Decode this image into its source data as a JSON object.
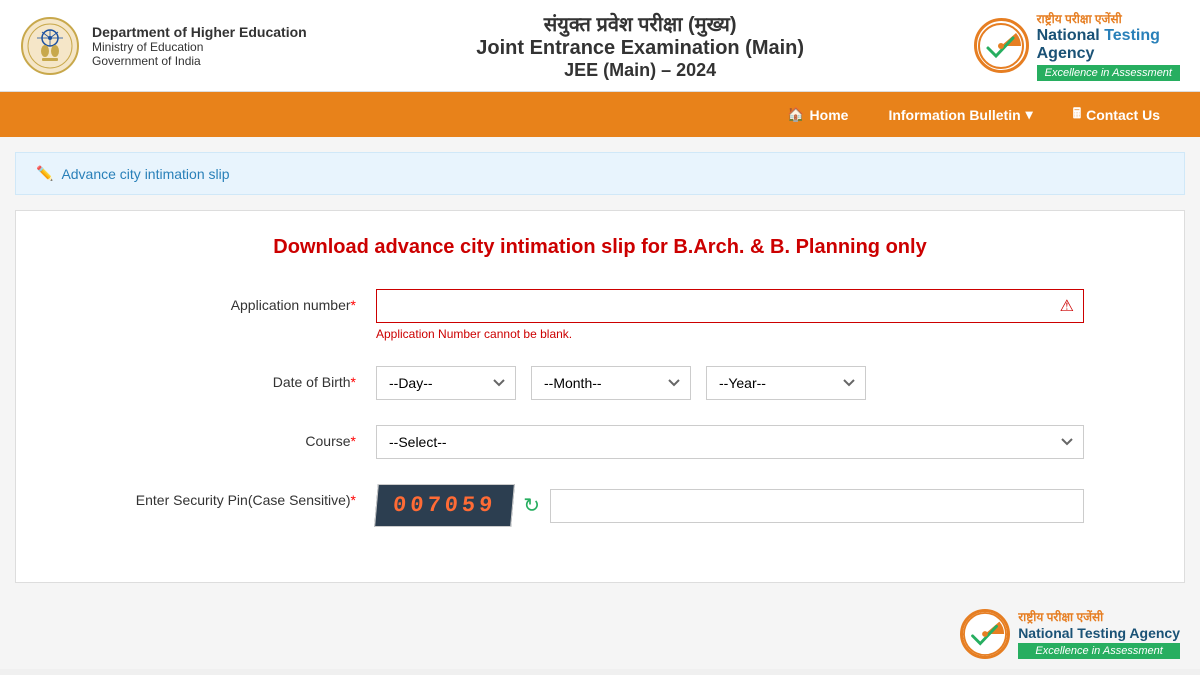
{
  "header": {
    "dept_name": "Department of Higher Education",
    "ministry": "Ministry of Education",
    "govt": "Government of India",
    "hindi_title": "संयुक्त प्रवेश परीक्षा (मुख्य)",
    "eng_title": "Joint Entrance Examination (Main)",
    "year_title": "JEE (Main) – 2024",
    "nta_hindi": "राष्ट्रीय परीक्षा एजेंसी",
    "nta_eng_national": "National",
    "nta_eng_testing": "Testing",
    "nta_eng_agency": "Agency",
    "nta_tagline": "Excellence in Assessment"
  },
  "navbar": {
    "home_label": "Home",
    "info_bulletin_label": "Information Bulletin",
    "contact_us_label": "Contact Us"
  },
  "breadcrumb": {
    "text": "Advance city intimation slip"
  },
  "form": {
    "title": "Download advance city intimation slip for B.Arch. & B. Planning only",
    "app_number_label": "Application number",
    "app_number_error": "Application Number cannot be blank.",
    "dob_label": "Date of Birth",
    "day_placeholder": "--Day--",
    "month_placeholder": "--Month--",
    "year_placeholder": "--Year--",
    "course_label": "Course",
    "course_placeholder": "--Select--",
    "security_pin_label": "Enter Security Pin(Case Sensitive)",
    "captcha_text": "007059",
    "required_mark": "*"
  }
}
